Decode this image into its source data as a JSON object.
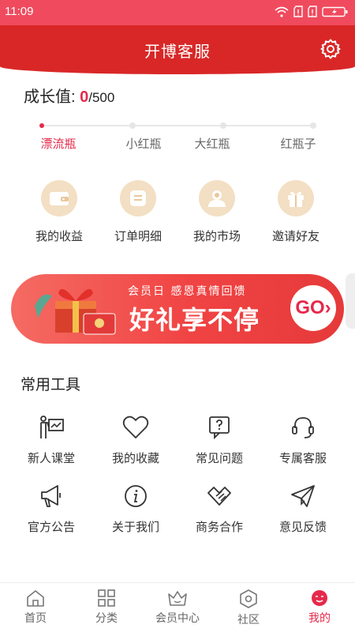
{
  "status": {
    "time": "11:09"
  },
  "header": {
    "title": "开博客服"
  },
  "growth": {
    "label": "成长值: ",
    "current": "0",
    "max": "/500"
  },
  "levels": [
    "漂流瓶",
    "小红瓶",
    "大红瓶",
    "红瓶子"
  ],
  "quick_actions": [
    "我的收益",
    "订单明细",
    "我的市场",
    "邀请好友"
  ],
  "banner": {
    "subtitle": "会员日 感恩真情回馈",
    "title": "好礼享不停",
    "cta": "GO›"
  },
  "tools": {
    "title": "常用工具",
    "items": [
      "新人课堂",
      "我的收藏",
      "常见问题",
      "专属客服",
      "官方公告",
      "关于我们",
      "商务合作",
      "意见反馈"
    ]
  },
  "tabbar": [
    "首页",
    "分类",
    "会员中心",
    "社区",
    "我的"
  ],
  "colors": {
    "accent": "#e6294b",
    "header": "#d92727",
    "statusbar": "#f04a5e"
  }
}
